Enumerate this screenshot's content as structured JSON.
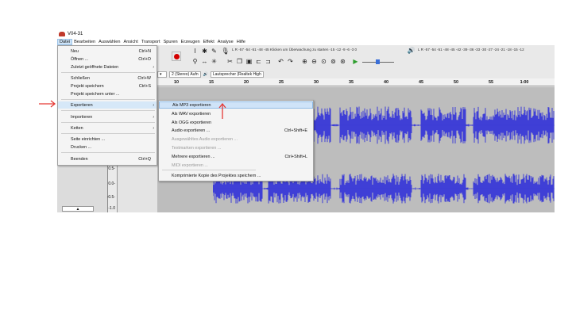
{
  "window": {
    "title": "V04-31"
  },
  "menubar": [
    "Datei",
    "Bearbeiten",
    "Auswählen",
    "Ansicht",
    "Transport",
    "Spuren",
    "Erzeugen",
    "Effekt",
    "Analyse",
    "Hilfe"
  ],
  "toolbar": {
    "meter_record": "L R -57 -54 -51 -48 -45 Klicken um Überwachung zu starten -15 -12 -9 -6 -3 0",
    "meter_play": "L R -57 -54 -51 -48 -45 -42 -39 -36 -33 -30 -27 -24 -21 -18 -15 -12"
  },
  "devices": {
    "input_channels": "2 (Stereo) Aufn",
    "output_device": "Lautsprecher (Realtek High"
  },
  "ruler": [
    "10",
    "15",
    "20",
    "25",
    "30",
    "35",
    "40",
    "45",
    "50",
    "55",
    "1:00"
  ],
  "scale": [
    "0.5-",
    "0.0-",
    "-0.5-",
    "-1.0"
  ],
  "file_menu": {
    "items": [
      {
        "label": "Neu",
        "shortcut": "Ctrl+N",
        "arrow": ""
      },
      {
        "label": "Öffnen ...",
        "shortcut": "Ctrl+O",
        "arrow": ""
      },
      {
        "label": "Zuletzt geöffnete Dateien",
        "shortcut": "",
        "arrow": "›"
      },
      {
        "label": "Schließen",
        "shortcut": "Ctrl+W",
        "arrow": ""
      },
      {
        "label": "Projekt speichern",
        "shortcut": "Ctrl+S",
        "arrow": ""
      },
      {
        "label": "Projekt speichern unter ...",
        "shortcut": "",
        "arrow": ""
      },
      {
        "label": "Exportieren",
        "shortcut": "",
        "arrow": "›"
      },
      {
        "label": "Importieren",
        "shortcut": "",
        "arrow": "›"
      },
      {
        "label": "Ketten",
        "shortcut": "",
        "arrow": "›"
      },
      {
        "label": "Seite einrichten ...",
        "shortcut": "",
        "arrow": ""
      },
      {
        "label": "Drucken ...",
        "shortcut": "",
        "arrow": ""
      },
      {
        "label": "Beenden",
        "shortcut": "Ctrl+Q",
        "arrow": ""
      }
    ]
  },
  "export_menu": {
    "items": [
      {
        "label": "Als MP3 exportieren",
        "shortcut": ""
      },
      {
        "label": "Als WAV exportieren",
        "shortcut": ""
      },
      {
        "label": "Als OGG exportieren",
        "shortcut": ""
      },
      {
        "label": "Audio exportieren ...",
        "shortcut": "Ctrl+Shift+E"
      },
      {
        "label": "Ausgewähltes Audio exportieren ...",
        "shortcut": ""
      },
      {
        "label": "Textmarken exportieren ...",
        "shortcut": ""
      },
      {
        "label": "Mehrere exportieren ...",
        "shortcut": "Ctrl+Shift+L"
      },
      {
        "label": "MIDI exportieren ...",
        "shortcut": ""
      },
      {
        "label": "Komprimierte Kopie des Projektes speichern ...",
        "shortcut": ""
      }
    ]
  },
  "colors": {
    "waveform": "#3f3fd6",
    "annotation": "#e53935",
    "highlight": "#d6e8f8"
  }
}
